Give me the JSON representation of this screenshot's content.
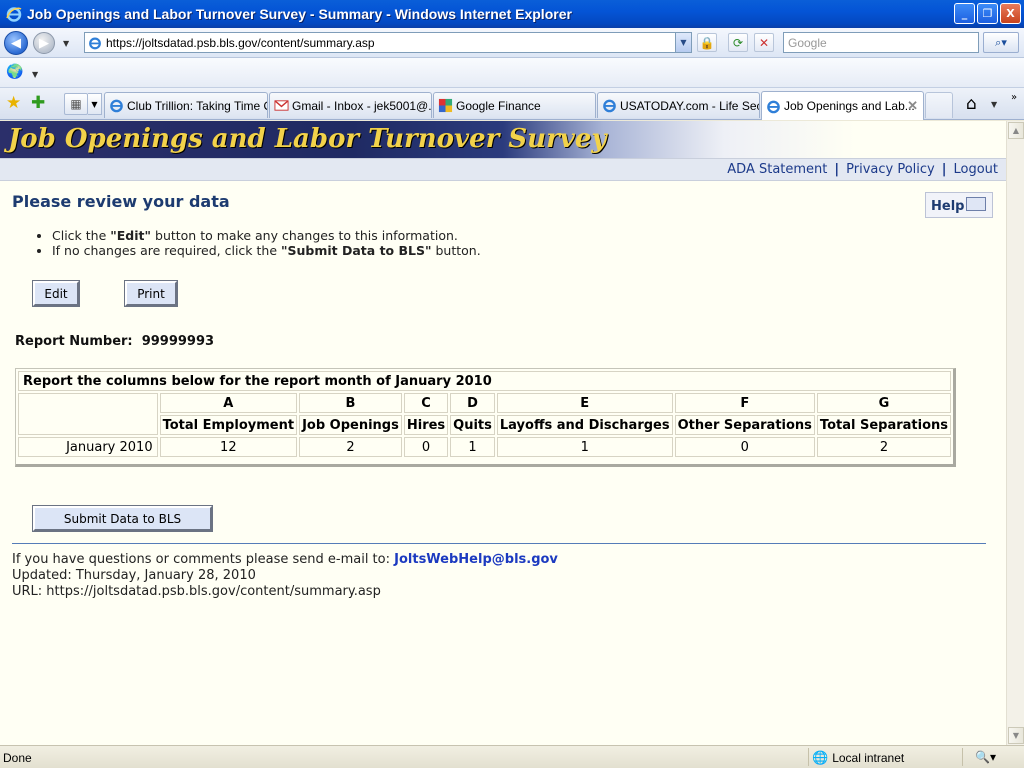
{
  "window": {
    "title": "Job Openings and Labor Turnover Survey - Summary - Windows Internet Explorer",
    "minimize": "_",
    "restore": "❐",
    "close": "X"
  },
  "address_bar": {
    "url": "https://joltsdatad.psb.bls.gov/content/summary.asp",
    "search_placeholder": "Google"
  },
  "tabs": [
    {
      "label": "Club Trillion: Taking Time Out",
      "active": false
    },
    {
      "label": "Gmail - Inbox - jek5001@...",
      "active": false
    },
    {
      "label": "Google Finance",
      "active": false
    },
    {
      "label": "USATODAY.com - Life Sec...",
      "active": false
    },
    {
      "label": "Job Openings and Lab...",
      "active": true
    }
  ],
  "page": {
    "banner_title": "Job Openings and Labor Turnover Survey",
    "top_links": [
      "ADA Statement",
      "Privacy Policy",
      "Logout"
    ],
    "link_separator": "|",
    "heading": "Please review your data",
    "help_label": "Help",
    "instructions": [
      {
        "pre": "Click the ",
        "bold": "\"Edit\"",
        "post": " button to make any changes to this information."
      },
      {
        "pre": "If no changes are required, click the ",
        "bold": "\"Submit Data to BLS\"",
        "post": " button."
      }
    ],
    "edit_button": "Edit",
    "print_button": "Print",
    "report_number_label": "Report Number:",
    "report_number": "99999993",
    "table": {
      "caption": "Report the columns below for the report month of January 2010",
      "letters": [
        "A",
        "B",
        "C",
        "D",
        "E",
        "F",
        "G"
      ],
      "headers": [
        "Total Employment",
        "Job Openings",
        "Hires",
        "Quits",
        "Layoffs and Discharges",
        "Other Separations",
        "Total Separations"
      ],
      "rows": [
        {
          "label": "January 2010",
          "values": [
            "12",
            "2",
            "0",
            "1",
            "1",
            "0",
            "2"
          ]
        }
      ]
    },
    "submit_button": "Submit Data to BLS",
    "footer": {
      "contact_text": "If you have questions or comments please send e-mail to: ",
      "email": "JoltsWebHelp@bls.gov",
      "updated": "Updated: Thursday, January 28, 2010",
      "url_line": "URL: https://joltsdatad.psb.bls.gov/content/summary.asp"
    }
  },
  "status_bar": {
    "status": "Done",
    "zone": "Local intranet",
    "zoom_icon": "🔍▾"
  }
}
